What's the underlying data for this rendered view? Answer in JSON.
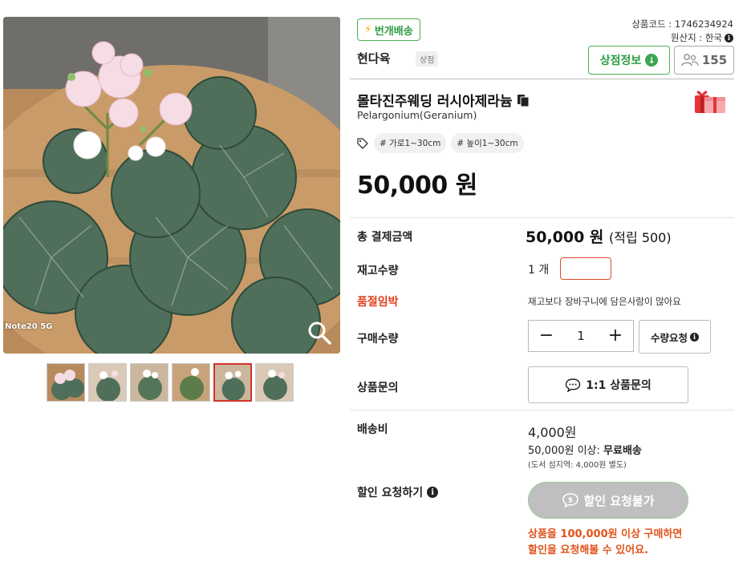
{
  "gallery": {
    "watermark": "Note20 5G",
    "zoom_icon": "magnifier-icon",
    "thumbnail_count": 6,
    "active_thumbnail": 5
  },
  "shop": {
    "fast_shipping_label": "번개배송",
    "name": "현다육",
    "tag": "상점",
    "info_button": "상점정보",
    "follower_count": "155"
  },
  "meta": {
    "product_code": "상품코드 : 1746234924",
    "origin": "원산지 : 한국"
  },
  "product": {
    "title": "몰타진주웨딩 러시아제라늄",
    "subtitle": "Pelargonium(Geranium)",
    "tags": [
      "# 가로1~30cm",
      "# 높이1~30cm"
    ],
    "price": "50,000 원"
  },
  "rows": {
    "total_label": "총 결제금액",
    "total_amount": "50,000 원",
    "total_points": "(적립 500)",
    "stock_label": "재고수량",
    "stock_value": "1 개",
    "soldout_label": "품절임박",
    "soldout_message": "재고보다 장바구니에 담은사람이 많아요",
    "quantity_label": "구매수량",
    "quantity_value": "1",
    "quantity_minus": "−",
    "quantity_plus": "+",
    "quantity_request": "수량요청",
    "inquiry_label": "상품문의",
    "inquiry_button": "1:1 상품문의",
    "shipping_label": "배송비",
    "shipping_value": "4,000원",
    "shipping_free_prefix": "50,000원 이상:",
    "shipping_free": "무료배송",
    "shipping_note": "(도서 섬지역: 4,000원 별도)",
    "discount_label": "할인 요청하기",
    "discount_button": "할인 요청불가",
    "discount_message": "상품을 100,000원 이상 구매하면 할인을 요청해볼 수 있어요."
  },
  "colors": {
    "accent_green": "#2e9d44",
    "warning_red": "#e2401c",
    "discount_orange": "#e2531c"
  }
}
